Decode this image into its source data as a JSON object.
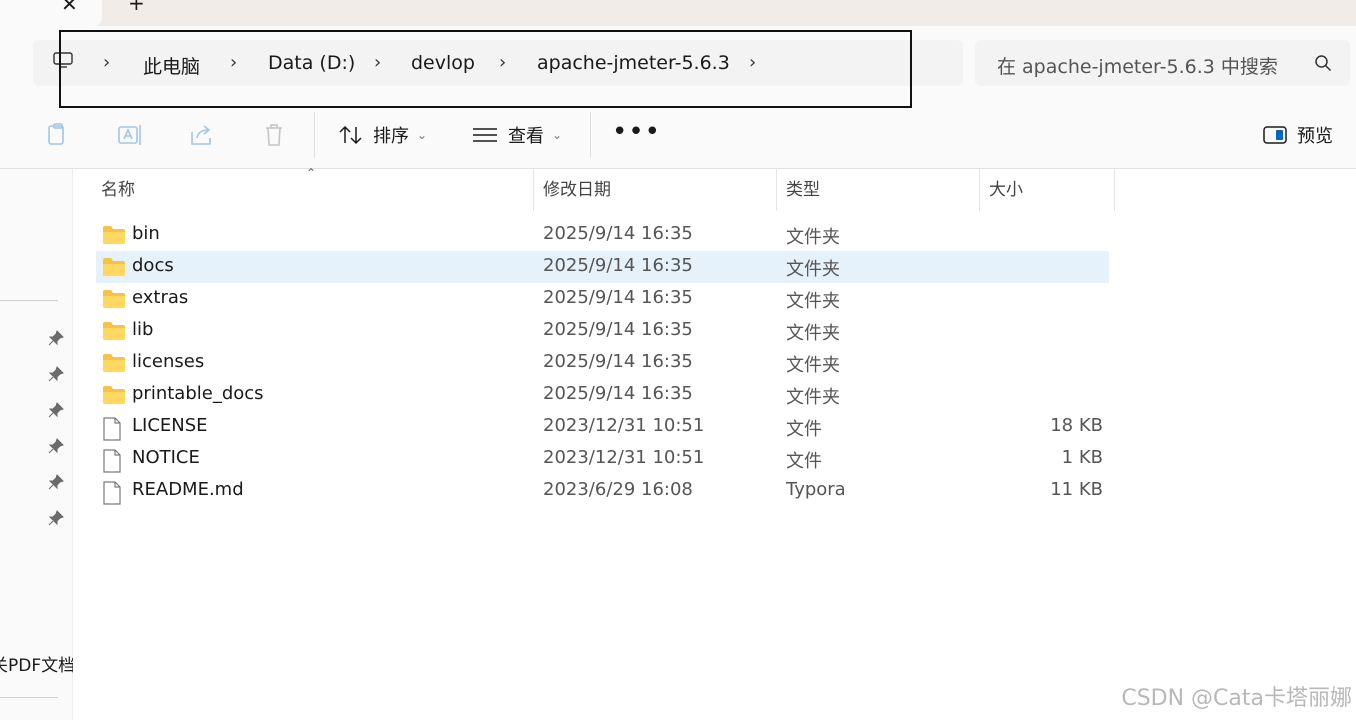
{
  "tabs": {
    "close_glyph": "✕",
    "new_glyph": "+"
  },
  "address": {
    "crumbs": [
      "此电脑",
      "Data (D:)",
      "devlop",
      "apache-jmeter-5.6.3"
    ],
    "separator": "›",
    "search_placeholder": "在 apache-jmeter-5.6.3 中搜索"
  },
  "toolbar": {
    "sort_label": "排序",
    "view_label": "查看",
    "more_label": "•••",
    "preview_label": "预览",
    "icons": [
      "copy-icon",
      "rename-icon",
      "share-icon",
      "delete-icon"
    ]
  },
  "nav": {
    "pinned_count": 6,
    "partial_label": "关PDF文档"
  },
  "columns": {
    "name": "名称",
    "date": "修改日期",
    "type": "类型",
    "size": "大小"
  },
  "files": [
    {
      "name": "bin",
      "date": "2025/9/14 16:35",
      "type": "文件夹",
      "size": "",
      "kind": "folder"
    },
    {
      "name": "docs",
      "date": "2025/9/14 16:35",
      "type": "文件夹",
      "size": "",
      "kind": "folder",
      "selected": true
    },
    {
      "name": "extras",
      "date": "2025/9/14 16:35",
      "type": "文件夹",
      "size": "",
      "kind": "folder"
    },
    {
      "name": "lib",
      "date": "2025/9/14 16:35",
      "type": "文件夹",
      "size": "",
      "kind": "folder"
    },
    {
      "name": "licenses",
      "date": "2025/9/14 16:35",
      "type": "文件夹",
      "size": "",
      "kind": "folder"
    },
    {
      "name": "printable_docs",
      "date": "2025/9/14 16:35",
      "type": "文件夹",
      "size": "",
      "kind": "folder"
    },
    {
      "name": "LICENSE",
      "date": "2023/12/31 10:51",
      "type": "文件",
      "size": "18 KB",
      "kind": "file"
    },
    {
      "name": "NOTICE",
      "date": "2023/12/31 10:51",
      "type": "文件",
      "size": "1 KB",
      "kind": "file"
    },
    {
      "name": "README.md",
      "date": "2023/6/29 16:08",
      "type": "Typora",
      "size": "11 KB",
      "kind": "file"
    }
  ],
  "watermark": "CSDN @Cata卡塔丽娜",
  "colors": {
    "selected_row": "#e5f1fb",
    "folder": "#f5c342",
    "accent": "#0067c0"
  }
}
